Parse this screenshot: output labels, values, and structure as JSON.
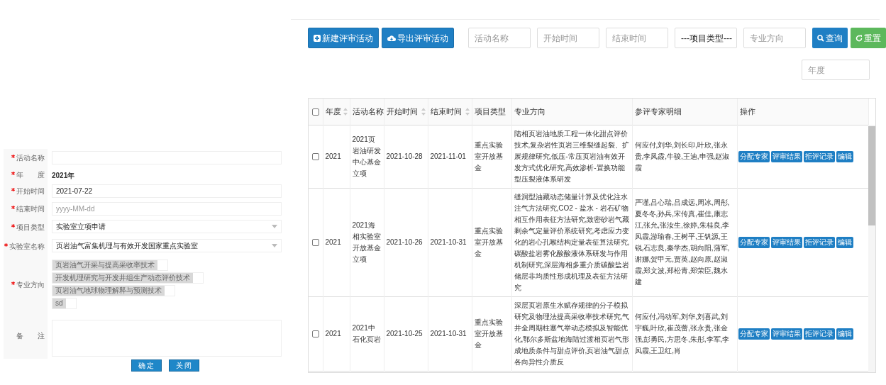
{
  "form": {
    "fields": [
      {
        "kind": "input",
        "label": "活动名称",
        "required": true
      },
      {
        "kind": "text",
        "label": "年　　度",
        "required": true,
        "value": "2021年"
      },
      {
        "kind": "input",
        "label": "开始时间",
        "required": true,
        "value": "2021-07-22"
      },
      {
        "kind": "input",
        "label": "结束时间",
        "required": true,
        "placeholder": "yyyy-MM-dd"
      },
      {
        "kind": "select",
        "label": "项目类型",
        "required": true,
        "value": "实验室立项申请"
      },
      {
        "kind": "select",
        "label": "实验室名称",
        "required": true,
        "value": "页岩油气富集机理与有效开发国家重点实验室"
      },
      {
        "kind": "tags",
        "label": "专业方向",
        "required": true,
        "tags": [
          "页岩油气开采与提高采收率技术",
          "开发机理研究与开发井组生产动态评价技术",
          "页岩油气地球物理解释与预测技术",
          "sd"
        ]
      },
      {
        "kind": "textarea",
        "label": "备　　注",
        "required": false
      }
    ],
    "buttons": [
      "确 定",
      "关 闭"
    ]
  },
  "toolbar": {
    "buttons": [
      "新建评审活动",
      "导出评审活动"
    ],
    "filters": [
      {
        "kind": "input",
        "placeholder": "活动名称"
      },
      {
        "kind": "input",
        "placeholder": "开始时间"
      },
      {
        "kind": "input",
        "placeholder": "结束时间"
      },
      {
        "kind": "select",
        "value": "---项目类型---"
      },
      {
        "kind": "input",
        "placeholder": "专业方向"
      }
    ],
    "search_button": "查询",
    "reset_button": "重置",
    "year_filter": {
      "placeholder": "年度"
    }
  },
  "table": {
    "columns": [
      {
        "label": "年度",
        "sortable": true
      },
      {
        "label": "活动名称",
        "sortable": false
      },
      {
        "label": "开始时间",
        "sortable": true
      },
      {
        "label": "结束时间",
        "sortable": true
      },
      {
        "label": "项目类型",
        "sortable": false
      },
      {
        "label": "专业方向",
        "sortable": false
      },
      {
        "label": "参评专家明细",
        "sortable": false
      },
      {
        "label": "操作",
        "sortable": false
      }
    ],
    "header_checked": false,
    "rows": [
      {
        "checked": false,
        "cells": [
          "2021",
          "2021页岩油研发中心基金立项",
          "2021-10-28",
          "2021-11-01",
          "重点实验室开放基金",
          "陆相页岩油地质工程一体化甜点评价技术,复杂岩性页岩三维裂缝起裂、扩展规律研究,低压-常压页岩油有效开发方式优化研究,高效渗析-置换功能型压裂液体系研发",
          "何应付,刘华,刘长印,叶欣,张永贵,李凤霞,牛骏,王迪,申强,赵淑霞"
        ],
        "actions": [
          "分配专家",
          "评审结果",
          "拒评记录",
          "编辑"
        ]
      },
      {
        "checked": false,
        "cells": [
          "2021",
          "2021海相实验室开放基金立项",
          "2021-10-26",
          "2021-10-31",
          "重点实验室开放基金",
          "缝洞型油藏动态储量计算及优化注水注气方法研究,CO2 - 盐水 - 岩石矿物相互作用表征方法研究,致密砂岩气藏剩余气定量评价系统研究,考虑应力变化的岩心孔喉结构定量表征算法研究,碳酸盐岩雾化酸酸液体系研发与作用机制研究,深层海相多重介质碳酸盐岩储层非均质性形成机理及表征方法研究",
          "严谨,吕心瑞,吕成远,周冰,周彤,夏冬冬,孙兵,宋传真,崔佳,康志江,张允,张汝生,徐婷,朱桂良,李凤霞,游瑜春,王树平,王钒源,王锐,石志良,秦学杰,胡向阳,蒲军,谢娜,贺甲元,贾英,赵向原,赵淑霞,郑文波,郑松青,郑荣臣,魏水建"
        ],
        "actions": [
          "分配专家",
          "评审结果",
          "拒评记录",
          "编辑"
        ]
      },
      {
        "checked": false,
        "cells": [
          "2021",
          "2021中石化页岩",
          "2021-10-25",
          "2021-10-31",
          "重点实验室开放基金",
          "深层页岩原生水赋存规律的分子模拟研究及物理法提高采收率技术研究,气井全周期柱塞气举动态模拟及智能优化,鄂尔多斯盆地海陆过渡相页岩气形成地质条件与甜点评价,页岩油气甜点各向异性介质反",
          "何应付,冯动军,刘华,刘喜武,刘宇巍,叶欣,崔茂蕾,张永贵,张金强,彭勇民,方思冬,朱彤,李军,李凤霞,王卫红,肖"
        ],
        "actions": [
          "分配专家",
          "评审结果",
          "拒评记录",
          "编辑"
        ]
      }
    ]
  }
}
